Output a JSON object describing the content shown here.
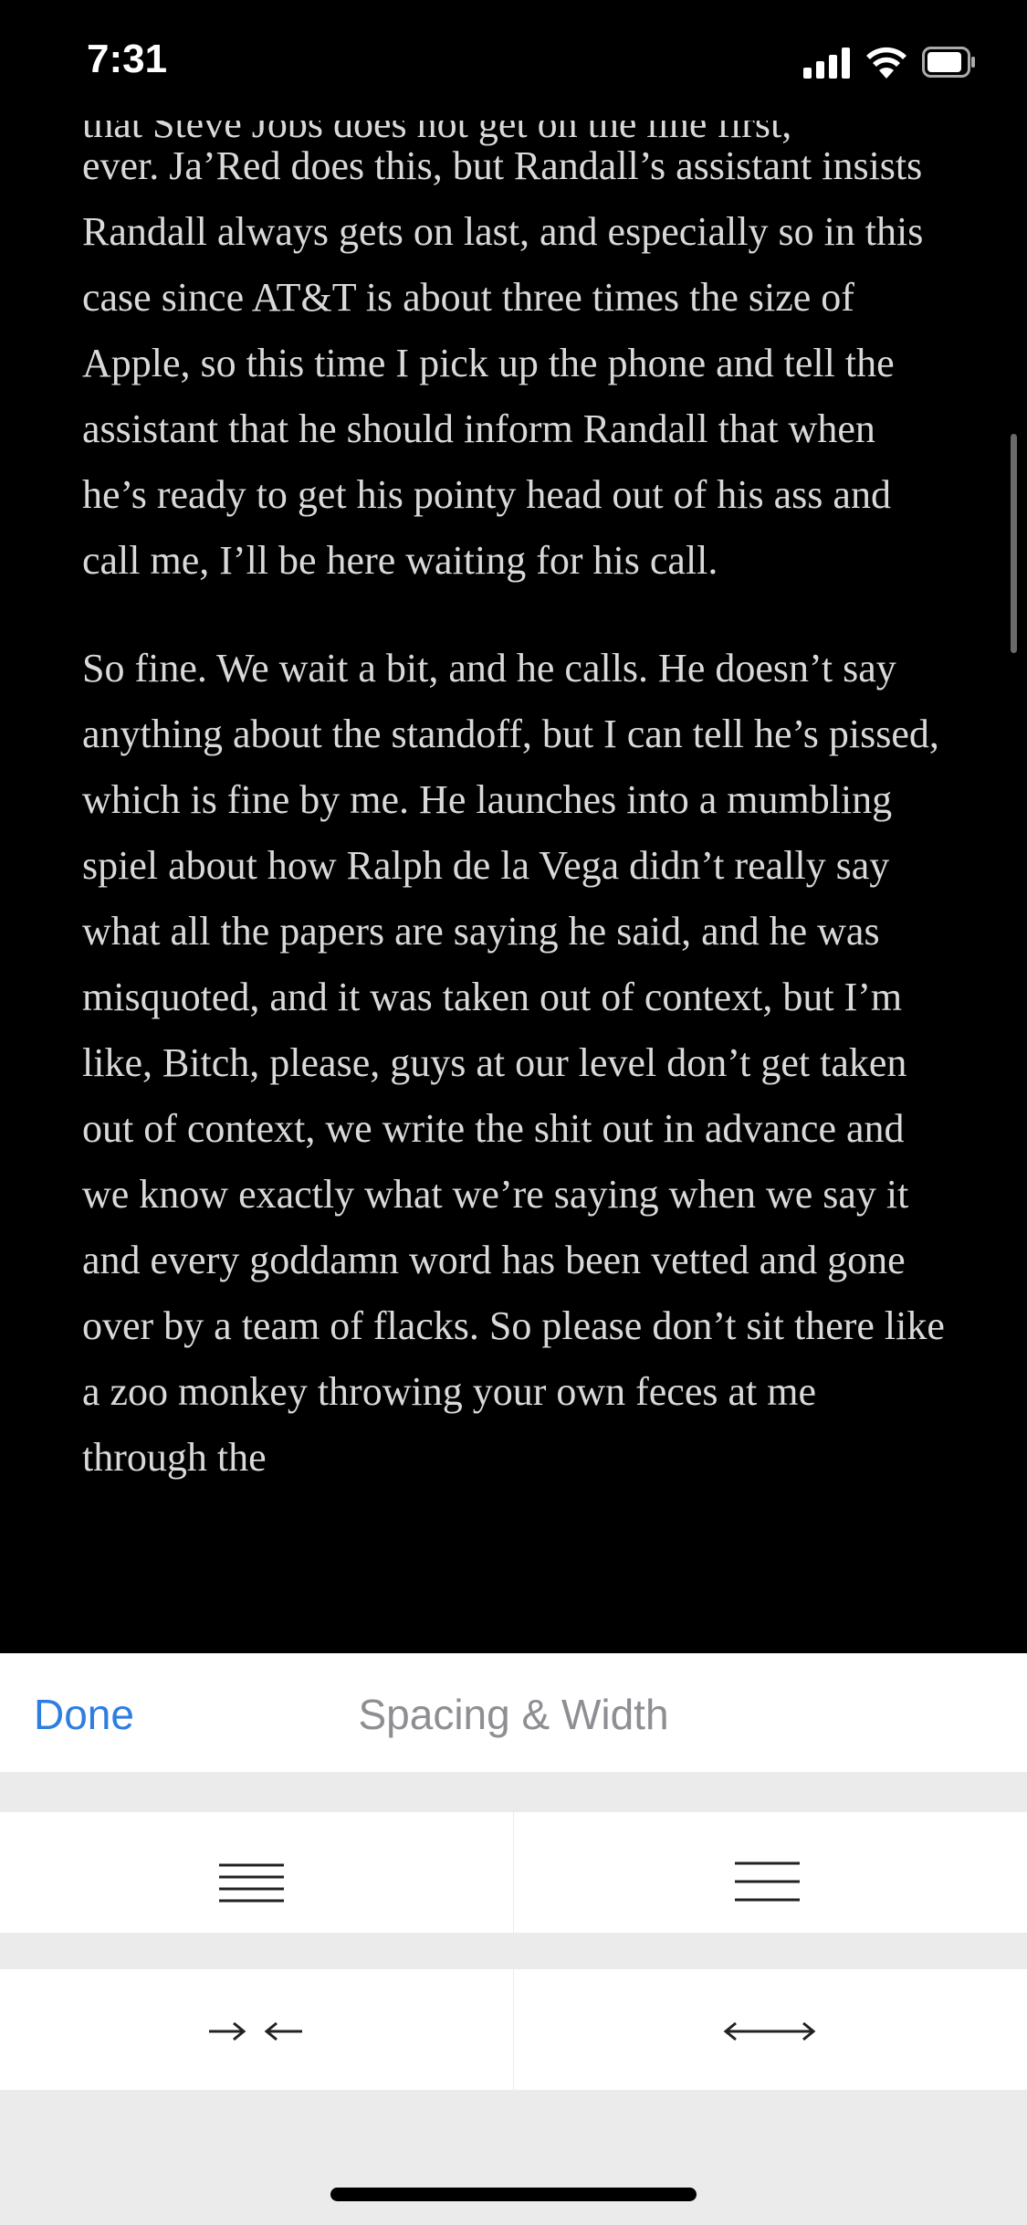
{
  "status_bar": {
    "time": "7:31",
    "icons": [
      "cellular-signal-icon",
      "wifi-icon",
      "battery-icon"
    ]
  },
  "article": {
    "partial_first_line": "that Steve Jobs does not get on the line first,",
    "paragraphs": [
      "ever. Ja’Red does this, but Randall’s assistant insists Randall always gets on last, and especially so in this case since AT&T is about three times the size of Apple, so this time I pick up the phone and tell the assistant that he should inform Randall that when he’s ready to get his pointy head out of his ass and call me, I’ll be here waiting for his call.",
      "So fine. We wait a bit, and he calls. He doesn’t say anything about the standoff, but I can tell he’s pissed, which is fine by me. He launches into a mumbling spiel about how Ralph de la Vega didn’t really say what all the papers are saying he said, and he was misquoted, and it was taken out of context, but I’m like, Bitch, please, guys at our level don’t get taken out of context, we write the shit out in advance and we know exactly what we’re saying when we say it and every goddamn word has been vetted and gone over by a team of flacks. So please don’t sit there like a zoo monkey throwing your own feces at me through the"
    ]
  },
  "panel": {
    "done_label": "Done",
    "title": "Spacing & Width",
    "spacing_options": [
      "compact-line-spacing-icon",
      "wide-line-spacing-icon"
    ],
    "width_options": [
      "narrow-width-icon",
      "wide-width-icon"
    ]
  },
  "colors": {
    "reader_background": "#000000",
    "reader_text": "#d9d9d9",
    "accent": "#2e7ee0",
    "panel_background": "#ebebeb"
  }
}
